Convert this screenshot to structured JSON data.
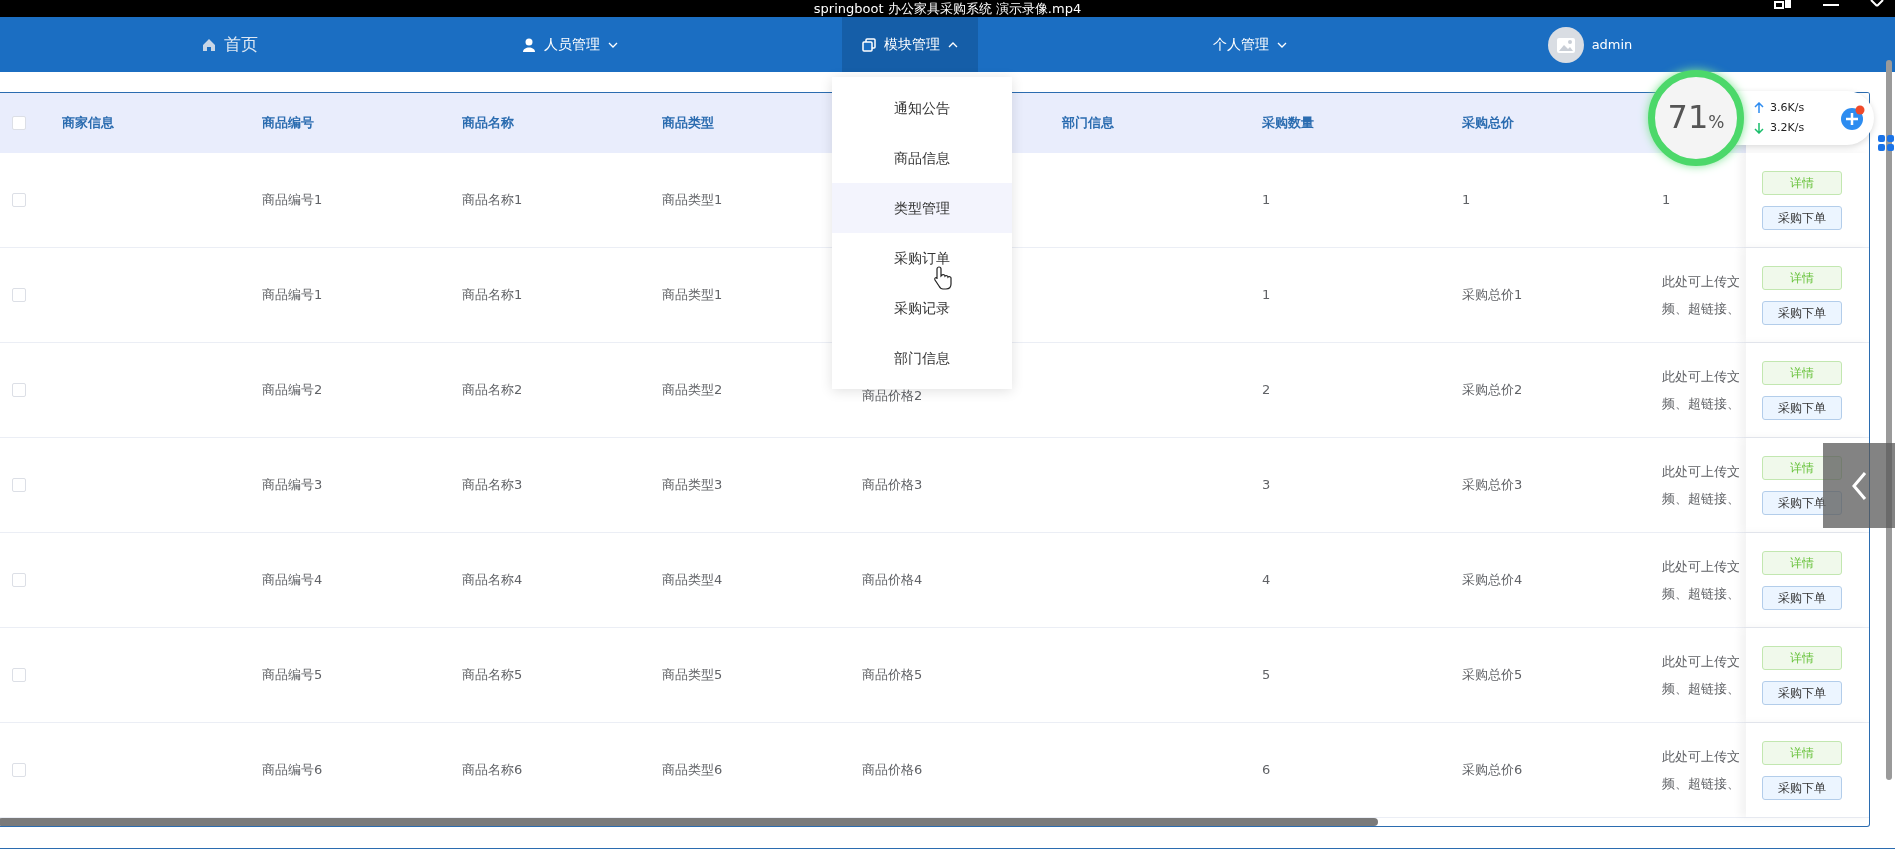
{
  "video_title": "springboot 办公家具采购系统 演示录像.mp4",
  "nav": [
    {
      "label": "首页",
      "selected": false
    },
    {
      "label": "人员管理",
      "selected": false,
      "expanded": false
    },
    {
      "label": "模块管理",
      "selected": true,
      "expanded": true
    },
    {
      "label": "个人管理",
      "selected": false,
      "expanded": false
    }
  ],
  "user": {
    "name": "admin"
  },
  "dropdown": {
    "items": [
      {
        "label": "通知公告",
        "hovered": false
      },
      {
        "label": "商品信息",
        "hovered": false
      },
      {
        "label": "类型管理",
        "hovered": true
      },
      {
        "label": "采购订单",
        "hovered": false
      },
      {
        "label": "采购记录",
        "hovered": false
      },
      {
        "label": "部门信息",
        "hovered": false
      }
    ]
  },
  "table": {
    "select_all_checked": false,
    "headers": {
      "merchant": "商家信息",
      "code": "商品编号",
      "name": "商品名称",
      "type": "商品类型",
      "department": "部门信息",
      "quantity": "采购数量",
      "total": "采购总价"
    },
    "rows": [
      {
        "checked": false,
        "code": "商品编号1",
        "name": "商品名称1",
        "type": "商品类型1",
        "quantity": "1",
        "total": "1",
        "column_9": [
          "1"
        ],
        "actions": [
          {
            "label": "详情",
            "kind": "success"
          },
          {
            "label": "采购下单",
            "kind": "primary"
          }
        ]
      },
      {
        "checked": false,
        "code": "商品编号1",
        "name": "商品名称1",
        "type": "商品类型1",
        "quantity": "1",
        "total": "采购总价1",
        "column_9": [
          "此处可上传文",
          "频、超链接、"
        ],
        "actions": [
          {
            "label": "详情",
            "kind": "success"
          },
          {
            "label": "采购下单",
            "kind": "primary"
          }
        ]
      },
      {
        "checked": false,
        "code": "商品编号2",
        "name": "商品名称2",
        "type": "商品类型2",
        "column_5": "商品价格2",
        "quantity": "2",
        "total": "采购总价2",
        "column_9": [
          "此处可上传文",
          "频、超链接、"
        ],
        "actions": [
          {
            "label": "详情",
            "kind": "success"
          },
          {
            "label": "采购下单",
            "kind": "primary"
          }
        ]
      },
      {
        "checked": false,
        "code": "商品编号3",
        "name": "商品名称3",
        "type": "商品类型3",
        "column_5": "商品价格3",
        "quantity": "3",
        "total": "采购总价3",
        "column_9": [
          "此处可上传文",
          "频、超链接、"
        ],
        "actions": [
          {
            "label": "详情",
            "kind": "success"
          },
          {
            "label": "采购下单",
            "kind": "primary"
          }
        ]
      },
      {
        "checked": false,
        "code": "商品编号4",
        "name": "商品名称4",
        "type": "商品类型4",
        "column_5": "商品价格4",
        "quantity": "4",
        "total": "采购总价4",
        "column_9": [
          "此处可上传文",
          "频、超链接、"
        ],
        "actions": [
          {
            "label": "详情",
            "kind": "success"
          },
          {
            "label": "采购下单",
            "kind": "primary"
          }
        ]
      },
      {
        "checked": false,
        "code": "商品编号5",
        "name": "商品名称5",
        "type": "商品类型5",
        "column_5": "商品价格5",
        "quantity": "5",
        "total": "采购总价5",
        "column_9": [
          "此处可上传文",
          "频、超链接、"
        ],
        "actions": [
          {
            "label": "详情",
            "kind": "success"
          },
          {
            "label": "采购下单",
            "kind": "primary"
          }
        ]
      },
      {
        "checked": false,
        "code": "商品编号6",
        "name": "商品名称6",
        "type": "商品类型6",
        "column_5": "商品价格6",
        "quantity": "6",
        "total": "采购总价6",
        "column_9": [
          "此处可上传文",
          "频、超链接、"
        ],
        "actions": [
          {
            "label": "详情",
            "kind": "success"
          },
          {
            "label": "采购下单",
            "kind": "primary"
          }
        ]
      }
    ]
  },
  "speed_widget": {
    "percent": "71",
    "unit": "%",
    "upload": "3.6K/s",
    "download": "3.2K/s"
  }
}
